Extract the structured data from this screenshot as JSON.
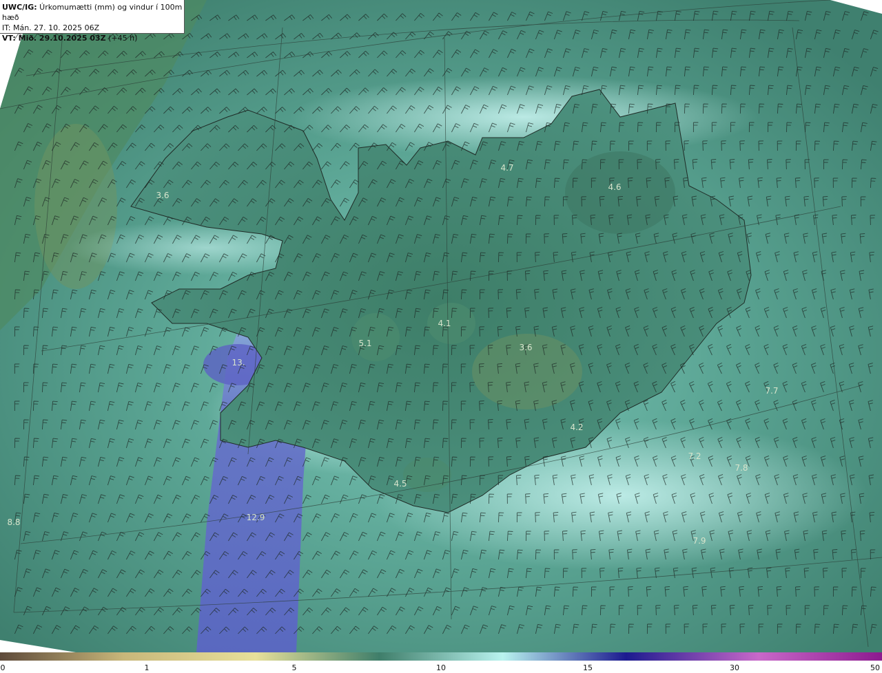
{
  "header": {
    "line1_bold": "UWC/IG:",
    "line1_text": " Úrkomumætti (mm) og vindur í 100m hæð",
    "line2": "IT: Mán. 27. 10. 2025 06Z",
    "line3_bold": "VT: Mið. 29.10.2025 03Z",
    "line3_text": " (+45 h)"
  },
  "labels": [
    "3.6",
    "4.7",
    "4.6",
    "4.1",
    "5.1",
    "3.6",
    "13.",
    "4.2",
    "4.5",
    "12.9",
    "7.2",
    "7.8",
    "7.7",
    "7.9",
    "8.8"
  ],
  "colorbar": {
    "ticks": [
      "0",
      "1",
      "5",
      "10",
      "15",
      "30",
      "50"
    ],
    "colors": [
      "#5e4a3a",
      "#c8b77a",
      "#e7e09a",
      "#3f7e6a",
      "#b9f3ef",
      "#1c1a8f",
      "#c868c9",
      "#8c1a8f"
    ]
  }
}
